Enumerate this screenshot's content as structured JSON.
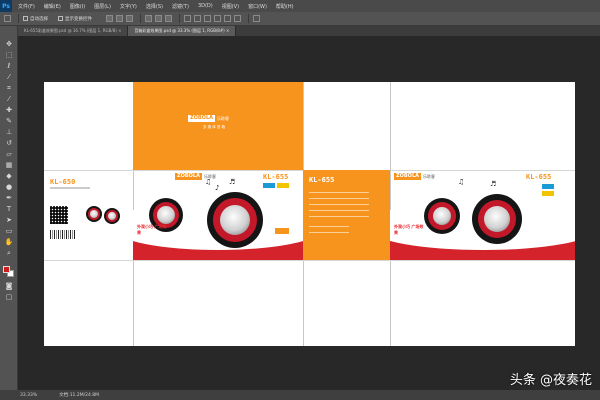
{
  "app": {
    "logo_text": "Ps"
  },
  "menu": [
    "文件(F)",
    "编辑(E)",
    "图像(I)",
    "图层(L)",
    "文字(Y)",
    "选择(S)",
    "滤镜(T)",
    "3D(D)",
    "视图(V)",
    "窗口(W)",
    "帮助(H)"
  ],
  "options": {
    "auto_select_label": "自动选择",
    "transform_label": "显示变换控件"
  },
  "tabs": [
    {
      "label": "KL-655彩盒效果图.psd @ 16.7% (图层 1, RGB/8) ×",
      "active": false
    },
    {
      "label": "音箱彩盒效果图.psd @ 33.3% (图层 1, RGB/8#) ×",
      "active": true
    }
  ],
  "document": {
    "brand_main": "ZOBOLA",
    "brand_tag": "乐聆客",
    "brand_sub": "多 媒 体 音 箱",
    "model_a": "KL-650",
    "model_b": "KL-655",
    "model_c": "KL-655",
    "front_model": "KL-650",
    "tagline_a": "外观小巧 广场效果",
    "tagline_b": "外观小巧 广场效果",
    "colors": {
      "orange": "#f7941d",
      "red": "#d4232a",
      "blue": "#1c9ad6"
    }
  },
  "status": {
    "zoom": "33.33%",
    "doc_size": "文档:11.2M/24.8M"
  },
  "watermark": "头条 @夜奏花"
}
